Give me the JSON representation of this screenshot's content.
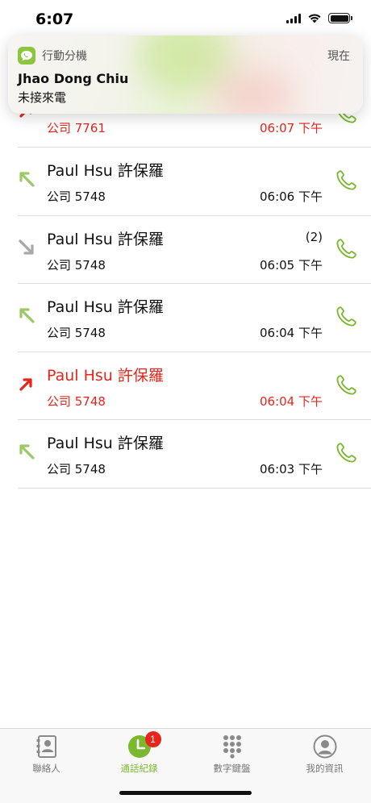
{
  "status_bar": {
    "time": "6:07"
  },
  "notification": {
    "app_name": "行動分機",
    "when": "現在",
    "title": "Jhao Dong Chiu",
    "body": "未接來電",
    "app_icon": "phone-bubble-icon"
  },
  "calls": [
    {
      "name": "",
      "number": "公司 7761",
      "time": "06:07 下午",
      "count": "",
      "direction": "outgoing-missed",
      "missed": true
    },
    {
      "name": "Paul Hsu 許保羅",
      "number": "公司 5748",
      "time": "06:06 下午",
      "count": "",
      "direction": "outgoing",
      "missed": false
    },
    {
      "name": "Paul Hsu 許保羅",
      "number": "公司 5748",
      "time": "06:05 下午",
      "count": "(2)",
      "direction": "incoming",
      "missed": false
    },
    {
      "name": "Paul Hsu 許保羅",
      "number": "公司 5748",
      "time": "06:04 下午",
      "count": "",
      "direction": "outgoing",
      "missed": false
    },
    {
      "name": "Paul Hsu 許保羅",
      "number": "公司 5748",
      "time": "06:04 下午",
      "count": "",
      "direction": "missed",
      "missed": true
    },
    {
      "name": "Paul Hsu 許保羅",
      "number": "公司 5748",
      "time": "06:03 下午",
      "count": "",
      "direction": "outgoing",
      "missed": false
    }
  ],
  "tabs": [
    {
      "label": "聯絡人",
      "icon": "contacts-icon",
      "active": false
    },
    {
      "label": "通話紀錄",
      "icon": "clock-icon",
      "active": true,
      "badge": "1"
    },
    {
      "label": "數字鍵盤",
      "icon": "keypad-icon",
      "active": false
    },
    {
      "label": "我的資訊",
      "icon": "profile-icon",
      "active": false
    }
  ],
  "colors": {
    "accent_green": "#7ab82f",
    "missed_red": "#e8251c",
    "incoming_gray": "#a8a8a8"
  }
}
